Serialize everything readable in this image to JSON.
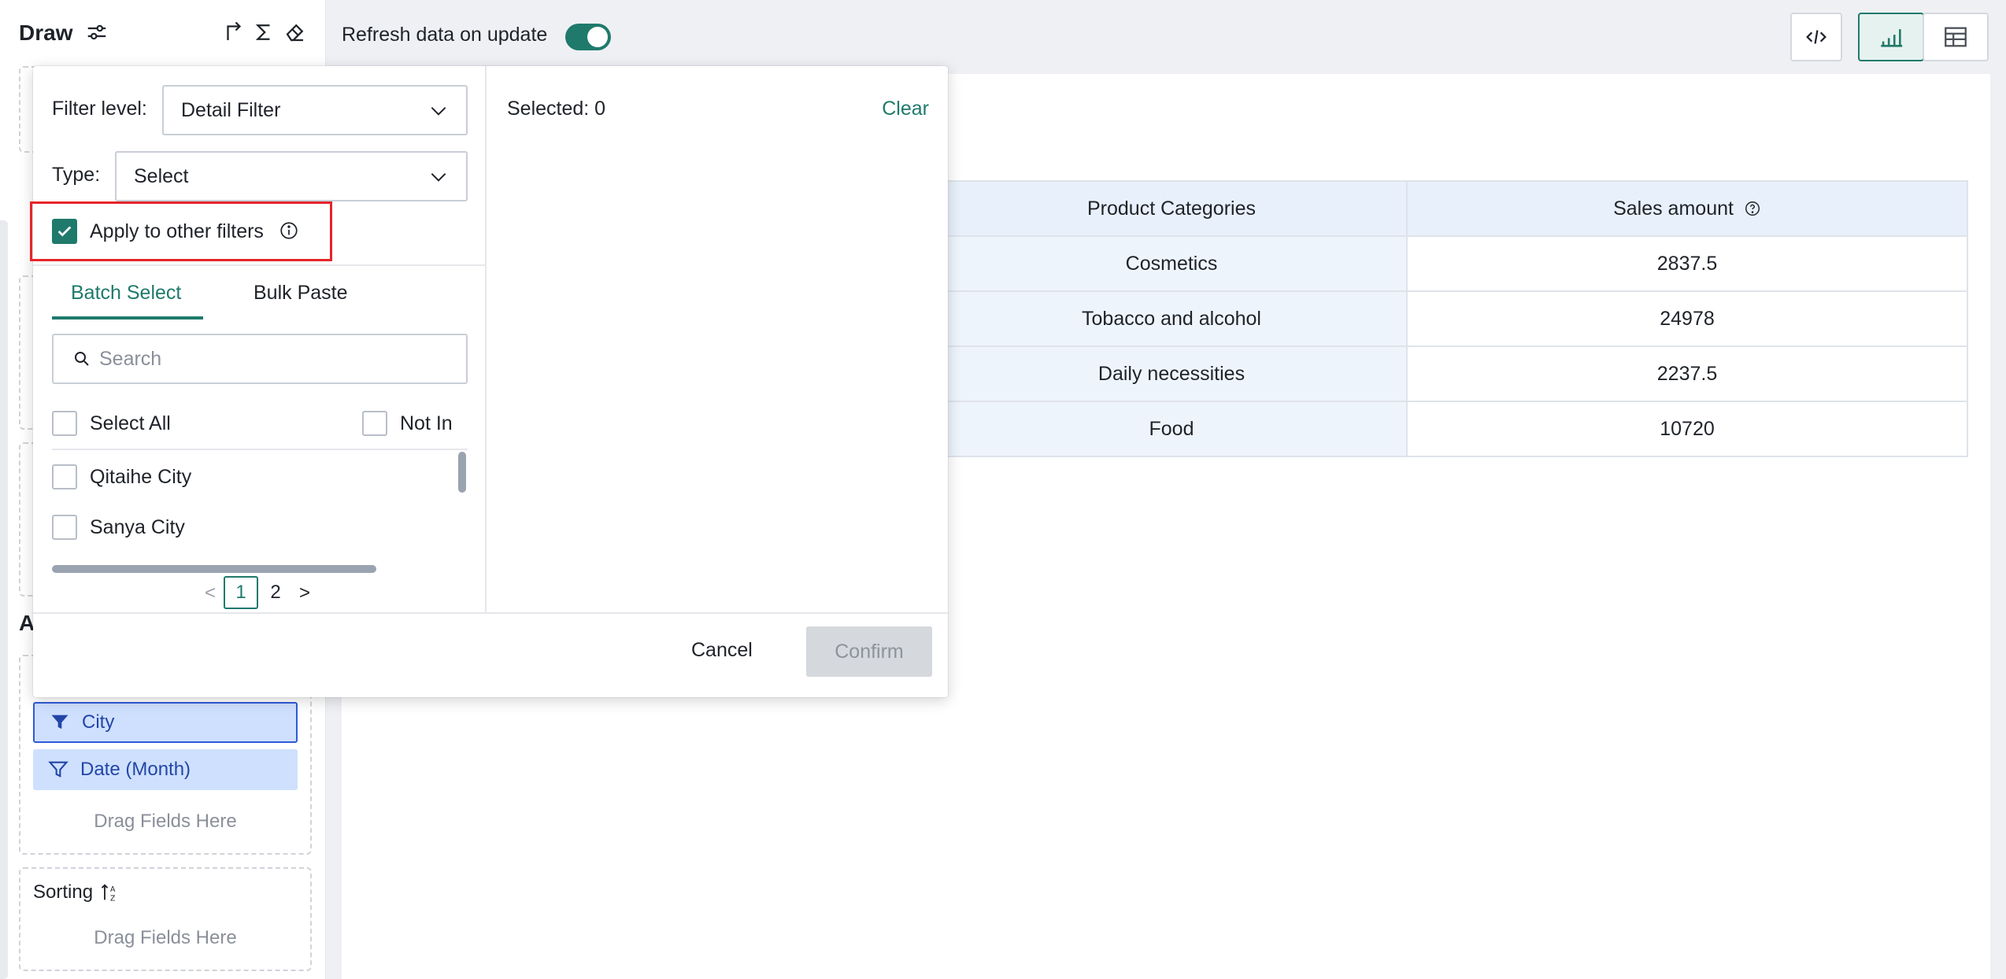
{
  "panel": {
    "title": "Draw",
    "filters_section_letter": "A",
    "filters": [
      {
        "label": "City",
        "active": true
      },
      {
        "label": "Date (Month)",
        "active": false
      }
    ],
    "drag_hint": "Drag Fields Here",
    "sorting_label": "Sorting",
    "sorting_drag_hint": "Drag Fields Here"
  },
  "topbar": {
    "refresh_label": "Refresh data on update",
    "refresh_on": true
  },
  "table": {
    "headers": [
      "Product Categories",
      "Sales amount"
    ],
    "rows": [
      [
        "Cosmetics",
        "2837.5"
      ],
      [
        "Tobacco and alcohol",
        "24978"
      ],
      [
        "Daily necessities",
        "2237.5"
      ],
      [
        "Food",
        "10720"
      ]
    ]
  },
  "filter_popup": {
    "filter_level_label": "Filter level:",
    "filter_level_value": "Detail Filter",
    "type_label": "Type:",
    "type_value": "Select",
    "apply_other_label": "Apply to other filters",
    "apply_other_checked": true,
    "tabs": [
      "Batch Select",
      "Bulk Paste"
    ],
    "active_tab": "Batch Select",
    "search_placeholder": "Search",
    "select_all_label": "Select All",
    "not_in_label": "Not In",
    "items": [
      "Qitaihe City",
      "Sanya City"
    ],
    "pages": [
      "1",
      "2"
    ],
    "current_page": "1",
    "selected_text": "Selected: 0",
    "clear_label": "Clear",
    "cancel_label": "Cancel",
    "confirm_label": "Confirm"
  },
  "colors": {
    "accent": "#1f7a6b",
    "chip_bg": "#cfe0ff",
    "chip_text": "#2246a8",
    "highlight": "#e5252a"
  }
}
